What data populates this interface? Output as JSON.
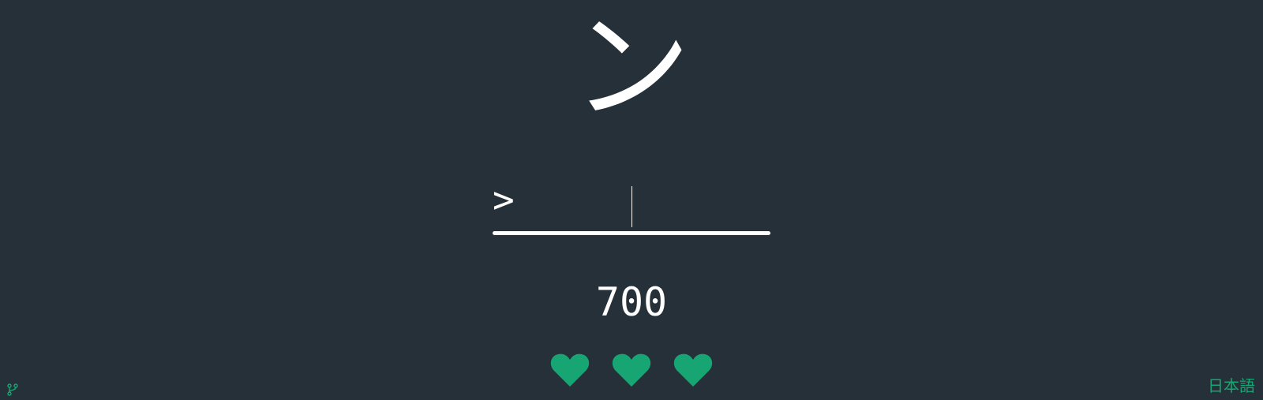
{
  "quiz": {
    "current_character": "ン",
    "prompt_symbol": ">",
    "answer_value": ""
  },
  "score": {
    "value": "700"
  },
  "lives": {
    "remaining": 3,
    "icon": "heart-icon",
    "color": "#17a673"
  },
  "footer": {
    "source_icon": "git-branch-icon",
    "language_label": "日本語"
  },
  "colors": {
    "background": "#263039",
    "foreground": "#ffffff",
    "accent": "#17a673"
  }
}
